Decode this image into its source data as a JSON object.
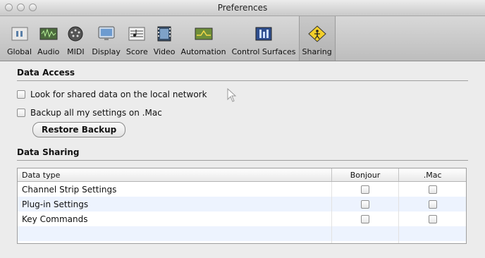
{
  "window": {
    "title": "Preferences"
  },
  "toolbar": {
    "items": [
      {
        "label": "Global",
        "icon": "global-icon"
      },
      {
        "label": "Audio",
        "icon": "audio-icon"
      },
      {
        "label": "MIDI",
        "icon": "midi-icon"
      },
      {
        "label": "Display",
        "icon": "display-icon"
      },
      {
        "label": "Score",
        "icon": "score-icon"
      },
      {
        "label": "Video",
        "icon": "video-icon"
      },
      {
        "label": "Automation",
        "icon": "automation-icon"
      },
      {
        "label": "Control Surfaces",
        "icon": "control-surfaces-icon"
      },
      {
        "label": "Sharing",
        "icon": "sharing-icon",
        "active": true
      }
    ]
  },
  "data_access": {
    "title": "Data Access",
    "look_shared_label": "Look for shared data on the local network",
    "backup_label": "Backup all my settings on .Mac",
    "restore_button": "Restore Backup"
  },
  "data_sharing": {
    "title": "Data Sharing",
    "columns": [
      "Data type",
      "Bonjour",
      ".Mac"
    ],
    "rows": [
      {
        "type": "Channel Strip Settings",
        "bonjour": false,
        "mac": false
      },
      {
        "type": "Plug-in Settings",
        "bonjour": false,
        "mac": false
      },
      {
        "type": "Key Commands",
        "bonjour": false,
        "mac": false
      }
    ]
  },
  "colors": {
    "row_alt": "#edf3fe",
    "toolbar_active": "#b1b1b1"
  }
}
